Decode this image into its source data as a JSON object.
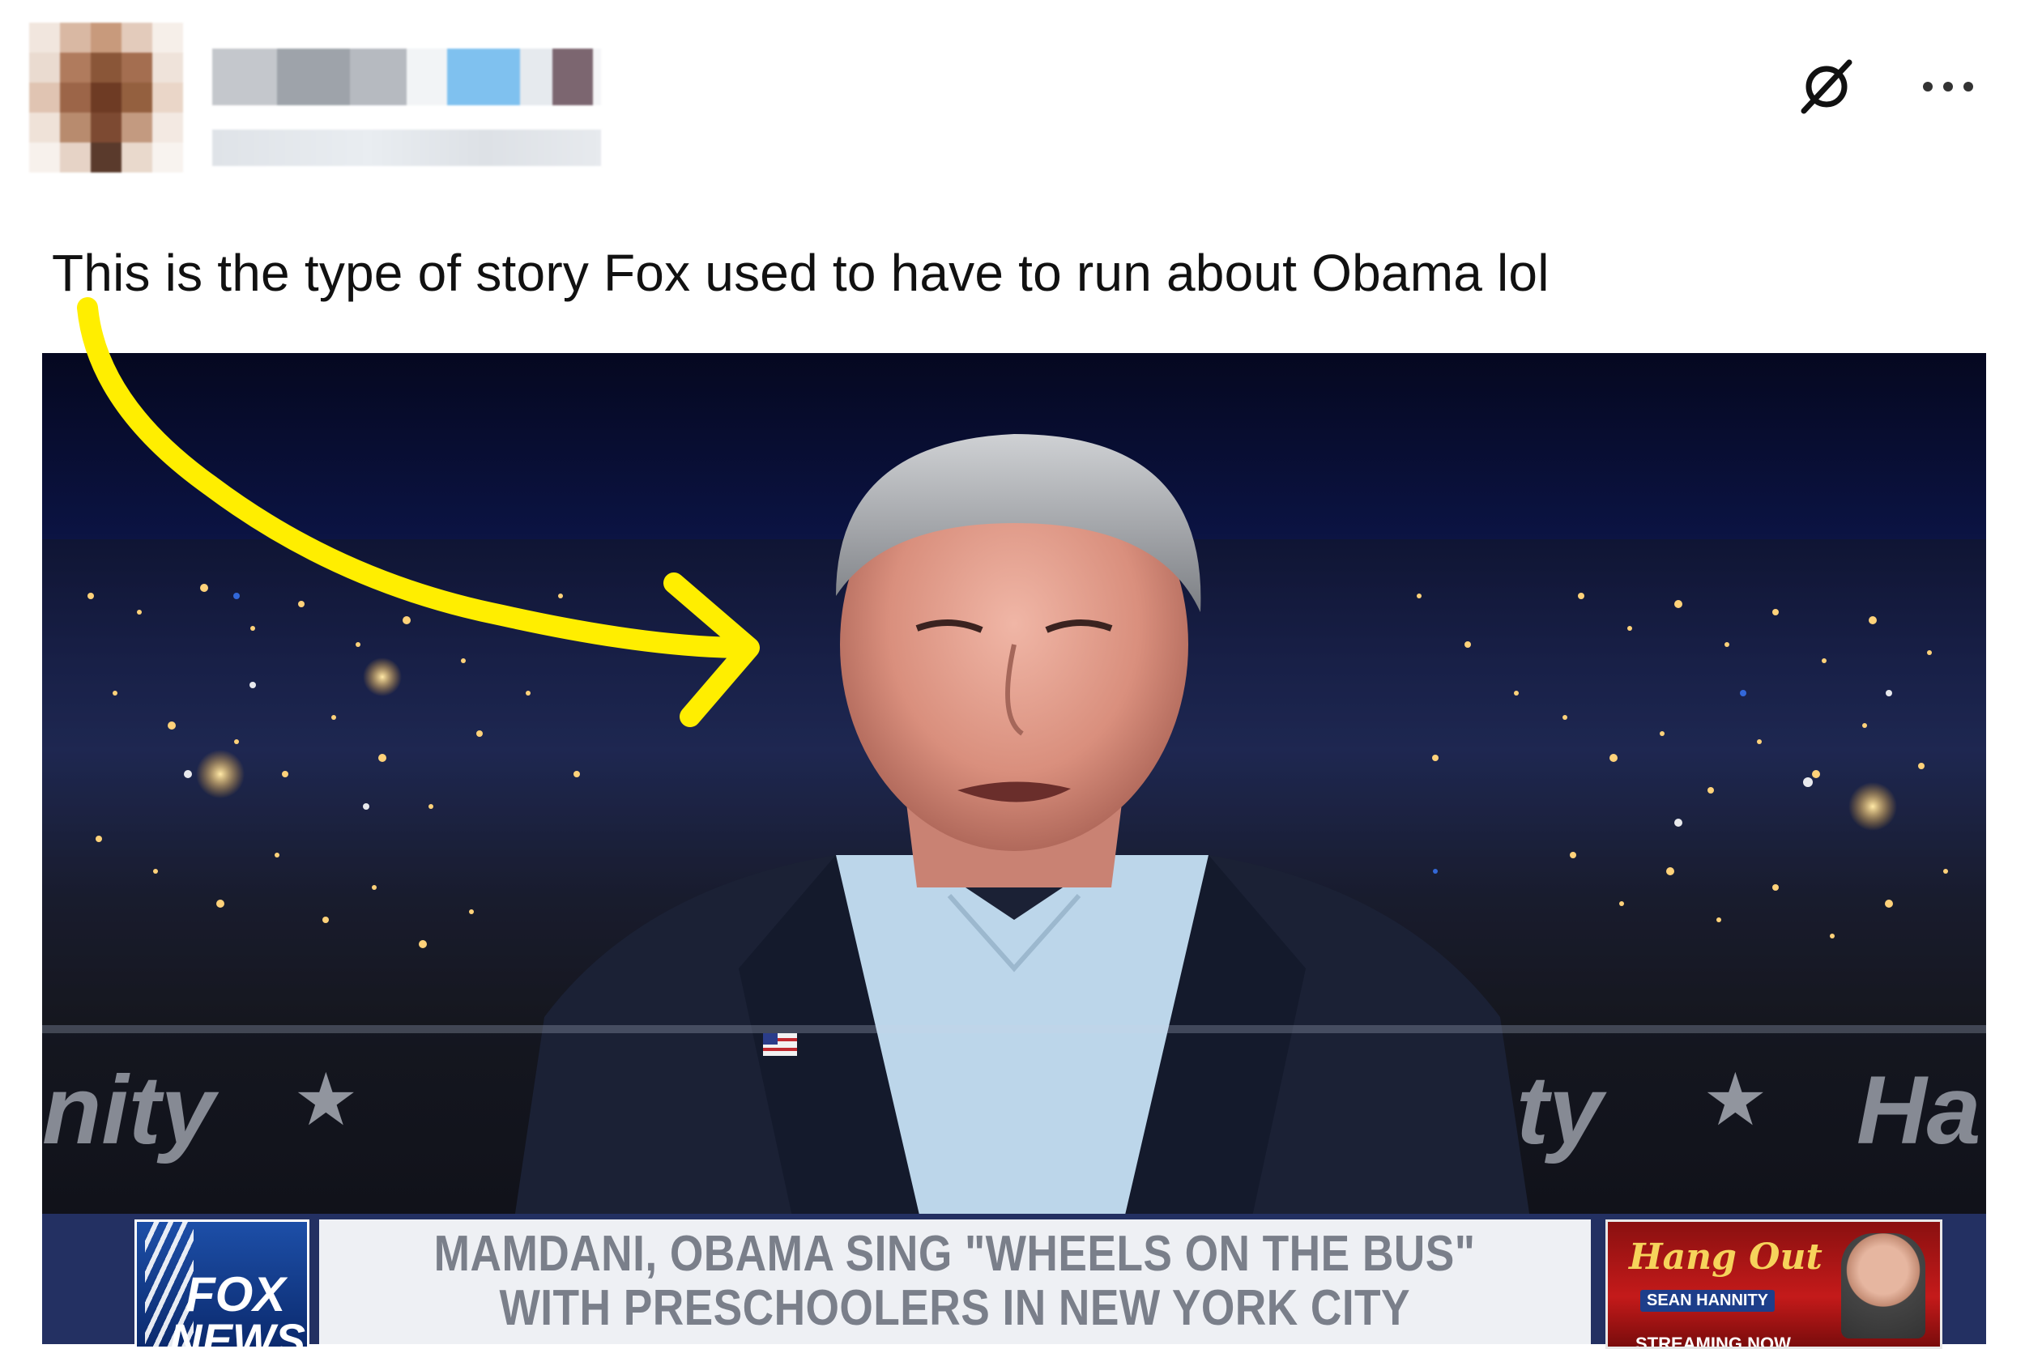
{
  "post": {
    "text": "This is the type of story Fox used to have to run about Obama lol"
  },
  "header": {
    "avatar": "blurred-avatar",
    "name": "",
    "icons": [
      "grok-icon",
      "more-icon"
    ]
  },
  "media": {
    "show_left": "nity",
    "show_right_partial": "ty",
    "show_right": "Ha",
    "network_logo": {
      "line1": "FOX",
      "line2": "NEWS"
    },
    "headline": {
      "line1": "MAMDANI, OBAMA SING \"WHEELS ON THE BUS\"",
      "line2": "WITH PRESCHOOLERS IN NEW YORK CITY"
    },
    "promo": {
      "title": "Hang Out",
      "subtitle": "SEAN HANNITY",
      "streaming": "STREAMING NOW"
    }
  },
  "colors": {
    "arrow": "#FFEE00",
    "text": "#111111",
    "lower_third": "#233062"
  }
}
